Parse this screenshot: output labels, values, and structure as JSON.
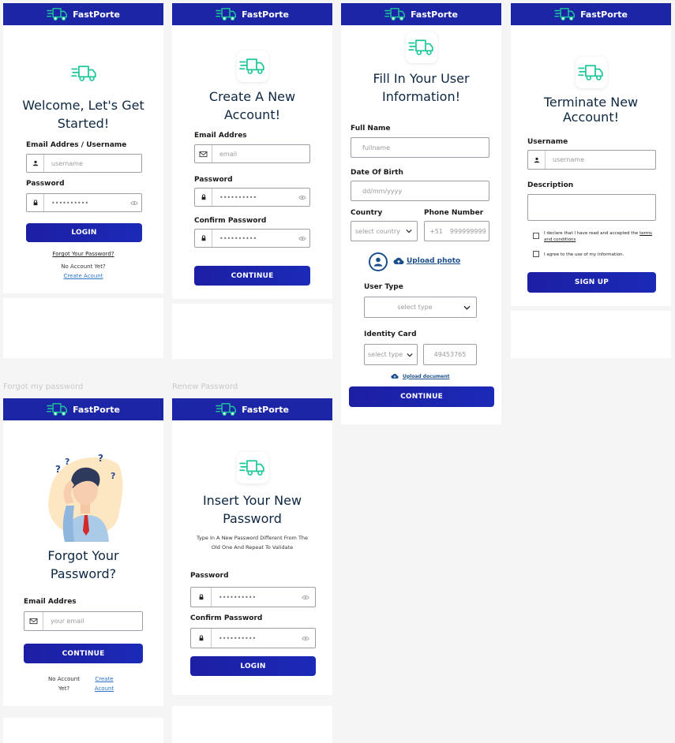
{
  "brand": "FastPorte",
  "colors": {
    "header": "#1b25a6",
    "button": "#1c1fa3",
    "truck": "#1ec79a",
    "link": "#2a73c9"
  },
  "captions": {
    "forgot": "Forgot my password",
    "renew": "Renew Password"
  },
  "login": {
    "title_line1": "Welcome, Let's Get",
    "title_line2": "Started!",
    "email_label": "Email Addres / Username",
    "email_placeholder": "username",
    "password_label": "Password",
    "password_value": "••••••••••",
    "login_button": "LOGIN",
    "forgot_link": "Forgot Your Password?",
    "no_account": "No Account Yet?",
    "create_link": "Create Acount"
  },
  "create": {
    "title_line1": "Create A New",
    "title_line2": "Account!",
    "email_label": "Email Addres",
    "email_placeholder": "email",
    "password_label": "Password",
    "password_value": "••••••••••",
    "confirm_label": "Confirm Password",
    "confirm_value": "••••••••••",
    "continue_button": "CONTINUE"
  },
  "info": {
    "title_line1": "Fill In Your User",
    "title_line2": "Information!",
    "fullname_label": "Full Name",
    "fullname_placeholder": "fullname",
    "dob_label": "Date Of Birth",
    "dob_placeholder": "dd/mm/yyyy",
    "country_label": "Country",
    "country_placeholder": "select country",
    "phone_label": "Phone Number",
    "phone_prefix": "+51",
    "phone_placeholder": "999999999",
    "upload_photo": "Upload photo",
    "usertype_label": "User Type",
    "usertype_placeholder": "select type",
    "idcard_label": "Identity Card",
    "idtype_placeholder": "select type",
    "id_number": "49453765",
    "upload_document": "Upload document",
    "continue_button": "CONTINUE"
  },
  "terminate": {
    "title_line1": "Terminate New",
    "title_line2": "Account!",
    "username_label": "Username",
    "username_placeholder": "username",
    "description_label": "Description",
    "declare_text": "I declare that I have read and accepted the ",
    "terms_link": "terms",
    "terms_link2": "and conditions",
    "agree_text": "I agree to the use of my information.",
    "signup_button": "SIGN UP"
  },
  "forgot": {
    "title_line1": "Forgot Your",
    "title_line2": "Password?",
    "email_label": "Email Addres",
    "email_placeholder": "your email",
    "continue_button": "CONTINUE",
    "no_account_1": "No Account",
    "no_account_2": "Yet?",
    "create_1": "Create",
    "create_2": "Acount"
  },
  "renew": {
    "title_line1": "Insert Your New",
    "title_line2": "Password",
    "subtitle_line1": "Type In A New Password Different From The",
    "subtitle_line2": "Old One And Repeat To Validate",
    "password_label": "Password",
    "password_value": "••••••••••",
    "confirm_label": "Confirm Password",
    "confirm_value": "••••••••••",
    "login_button": "LOGIN"
  }
}
